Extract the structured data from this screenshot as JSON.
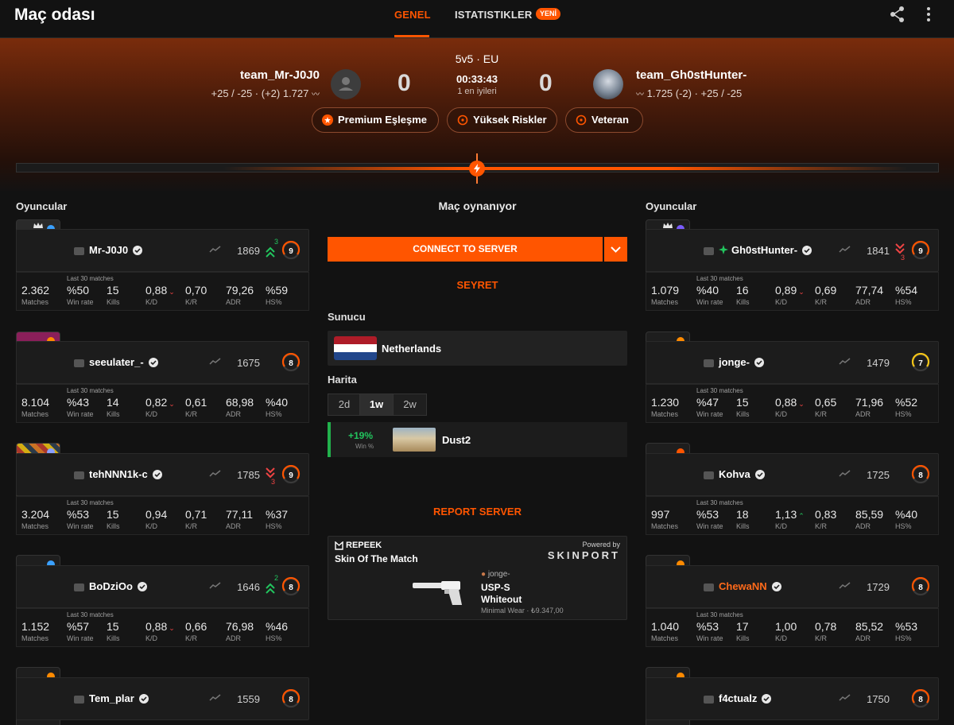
{
  "app": {
    "title": "Maç odası"
  },
  "tabs": {
    "general": "GENEL",
    "stats": "ISTATISTIKLER",
    "new_badge": "YENİ"
  },
  "match": {
    "mode": "5v5 · EU",
    "timer": "00:33:43",
    "best_of": "1 en iyileri",
    "team_left": {
      "name": "team_Mr-J0J0",
      "score": "0",
      "meta": "+25 / -25  ·  (+2) 1.727"
    },
    "team_right": {
      "name": "team_Gh0stHunter-",
      "score": "0",
      "meta": "1.725 (-2)  ·  +25 / -25"
    },
    "pills": [
      "Premium Eşleşme",
      "Yüksek Riskler",
      "Veteran"
    ],
    "progress": 0.5
  },
  "columns": {
    "left_title": "Oyuncular",
    "right_title": "Oyuncular"
  },
  "stat_labels": {
    "last30": "Last 30 matches",
    "matches": "Matches",
    "winrate": "Win rate",
    "kills": "Kills",
    "kd": "K/D",
    "kr": "K/R",
    "adr": "ADR",
    "hs": "HS%"
  },
  "players_left": [
    {
      "name": "Mr-J0J0",
      "elo": "1869",
      "level": "9",
      "change": "3",
      "direction": "up",
      "matches": "2.362",
      "winrate": "%50",
      "kills": "15",
      "kd": "0,88",
      "kd_dir": "down",
      "kr": "0,70",
      "adr": "79,26",
      "hs": "%59"
    },
    {
      "name": "seeulater_-",
      "elo": "1675",
      "level": "8",
      "change": "",
      "direction": "",
      "matches": "8.104",
      "winrate": "%43",
      "kills": "14",
      "kd": "0,82",
      "kd_dir": "down",
      "kr": "0,61",
      "adr": "68,98",
      "hs": "%40"
    },
    {
      "name": "tehNNN1k-c",
      "elo": "1785",
      "level": "9",
      "change": "3",
      "direction": "down",
      "matches": "3.204",
      "winrate": "%53",
      "kills": "15",
      "kd": "0,94",
      "kd_dir": "",
      "kr": "0,71",
      "adr": "77,11",
      "hs": "%37"
    },
    {
      "name": "BoDziOo",
      "elo": "1646",
      "level": "8",
      "change": "2",
      "direction": "up",
      "matches": "1.152",
      "winrate": "%57",
      "kills": "15",
      "kd": "0,88",
      "kd_dir": "down",
      "kr": "0,66",
      "adr": "76,98",
      "hs": "%46"
    },
    {
      "name": "Tem_plar",
      "elo": "1559",
      "level": "8"
    }
  ],
  "players_right": [
    {
      "name": "Gh0stHunter-",
      "elo": "1841",
      "level": "9",
      "change": "3",
      "direction": "down",
      "matches": "1.079",
      "winrate": "%40",
      "kills": "16",
      "kd": "0,89",
      "kd_dir": "down",
      "kr": "0,69",
      "adr": "77,74",
      "hs": "%54"
    },
    {
      "name": "jonge-",
      "elo": "1479",
      "level": "7",
      "change": "",
      "direction": "",
      "matches": "1.230",
      "winrate": "%47",
      "kills": "15",
      "kd": "0,88",
      "kd_dir": "down",
      "kr": "0,65",
      "adr": "71,96",
      "hs": "%52"
    },
    {
      "name": "Kohva",
      "elo": "1725",
      "level": "8",
      "change": "",
      "direction": "",
      "matches": "997",
      "winrate": "%53",
      "kills": "18",
      "kd": "1,13",
      "kd_dir": "up",
      "kr": "0,83",
      "adr": "85,59",
      "hs": "%40"
    },
    {
      "name": "ChewaNN",
      "elo": "1729",
      "level": "8",
      "change": "",
      "direction": "",
      "matches": "1.040",
      "winrate": "%53",
      "kills": "17",
      "kd": "1,00",
      "kd_dir": "",
      "kr": "0,78",
      "adr": "85,52",
      "hs": "%53"
    },
    {
      "name": "f4ctualz",
      "elo": "1750",
      "level": "8"
    }
  ],
  "middle": {
    "status": "Maç oynanıyor",
    "connect": "CONNECT TO SERVER",
    "watch": "SEYRET",
    "server_label": "Sunucu",
    "server": "Netherlands",
    "map_label": "Harita",
    "ranges": [
      "2d",
      "1w",
      "2w"
    ],
    "map_winrate": "+19%",
    "map_win_label": "Win %",
    "map_name": "Dust2",
    "report": "REPORT SERVER"
  },
  "skin": {
    "brand": "REPEEK",
    "title": "Skin Of The Match",
    "powered": "Powered by",
    "partner": "SKINPORT",
    "owner": "jonge-",
    "weapon": "USP-S",
    "skin_name": "Whiteout",
    "wear_price": "Minimal Wear · ₺9.347,00"
  },
  "colors": {
    "accent": "#ff5500",
    "up": "#22c55e",
    "down": "#ef4444",
    "bg": "#121212"
  }
}
